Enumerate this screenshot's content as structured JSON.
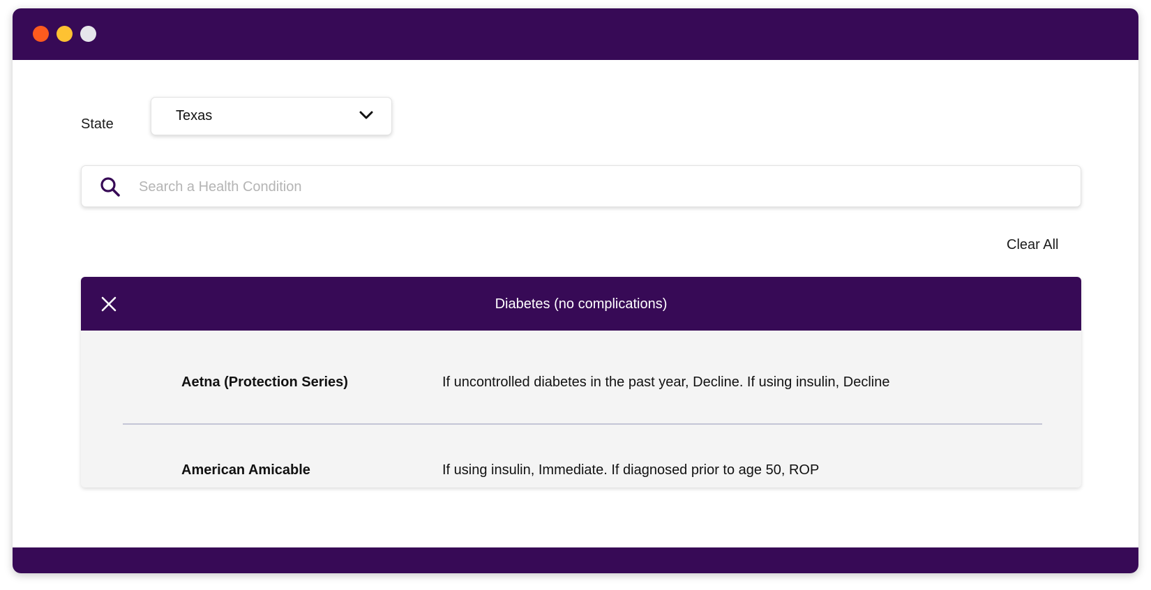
{
  "colors": {
    "brand": "#370a56",
    "traffic_red": "#fe5b1e",
    "traffic_yellow": "#fec232",
    "traffic_gray": "#e6e6eb",
    "card_bg": "#f4f4f4",
    "divider": "#c3c5d6"
  },
  "filters": {
    "state_label": "State",
    "state_value": "Texas"
  },
  "search": {
    "placeholder": "Search a Health Condition",
    "value": ""
  },
  "actions": {
    "clear_all": "Clear All"
  },
  "condition": {
    "title": "Diabetes (no complications)",
    "rows": [
      {
        "carrier": "Aetna (Protection Series)",
        "rule": "If uncontrolled diabetes in the past year, Decline. If using insulin, Decline"
      },
      {
        "carrier": "American Amicable",
        "rule": "If using insulin, Immediate. If diagnosed prior to age 50, ROP"
      }
    ]
  },
  "icons": {
    "dropdown": "chevron-down-icon",
    "search": "search-icon",
    "close": "close-icon"
  }
}
